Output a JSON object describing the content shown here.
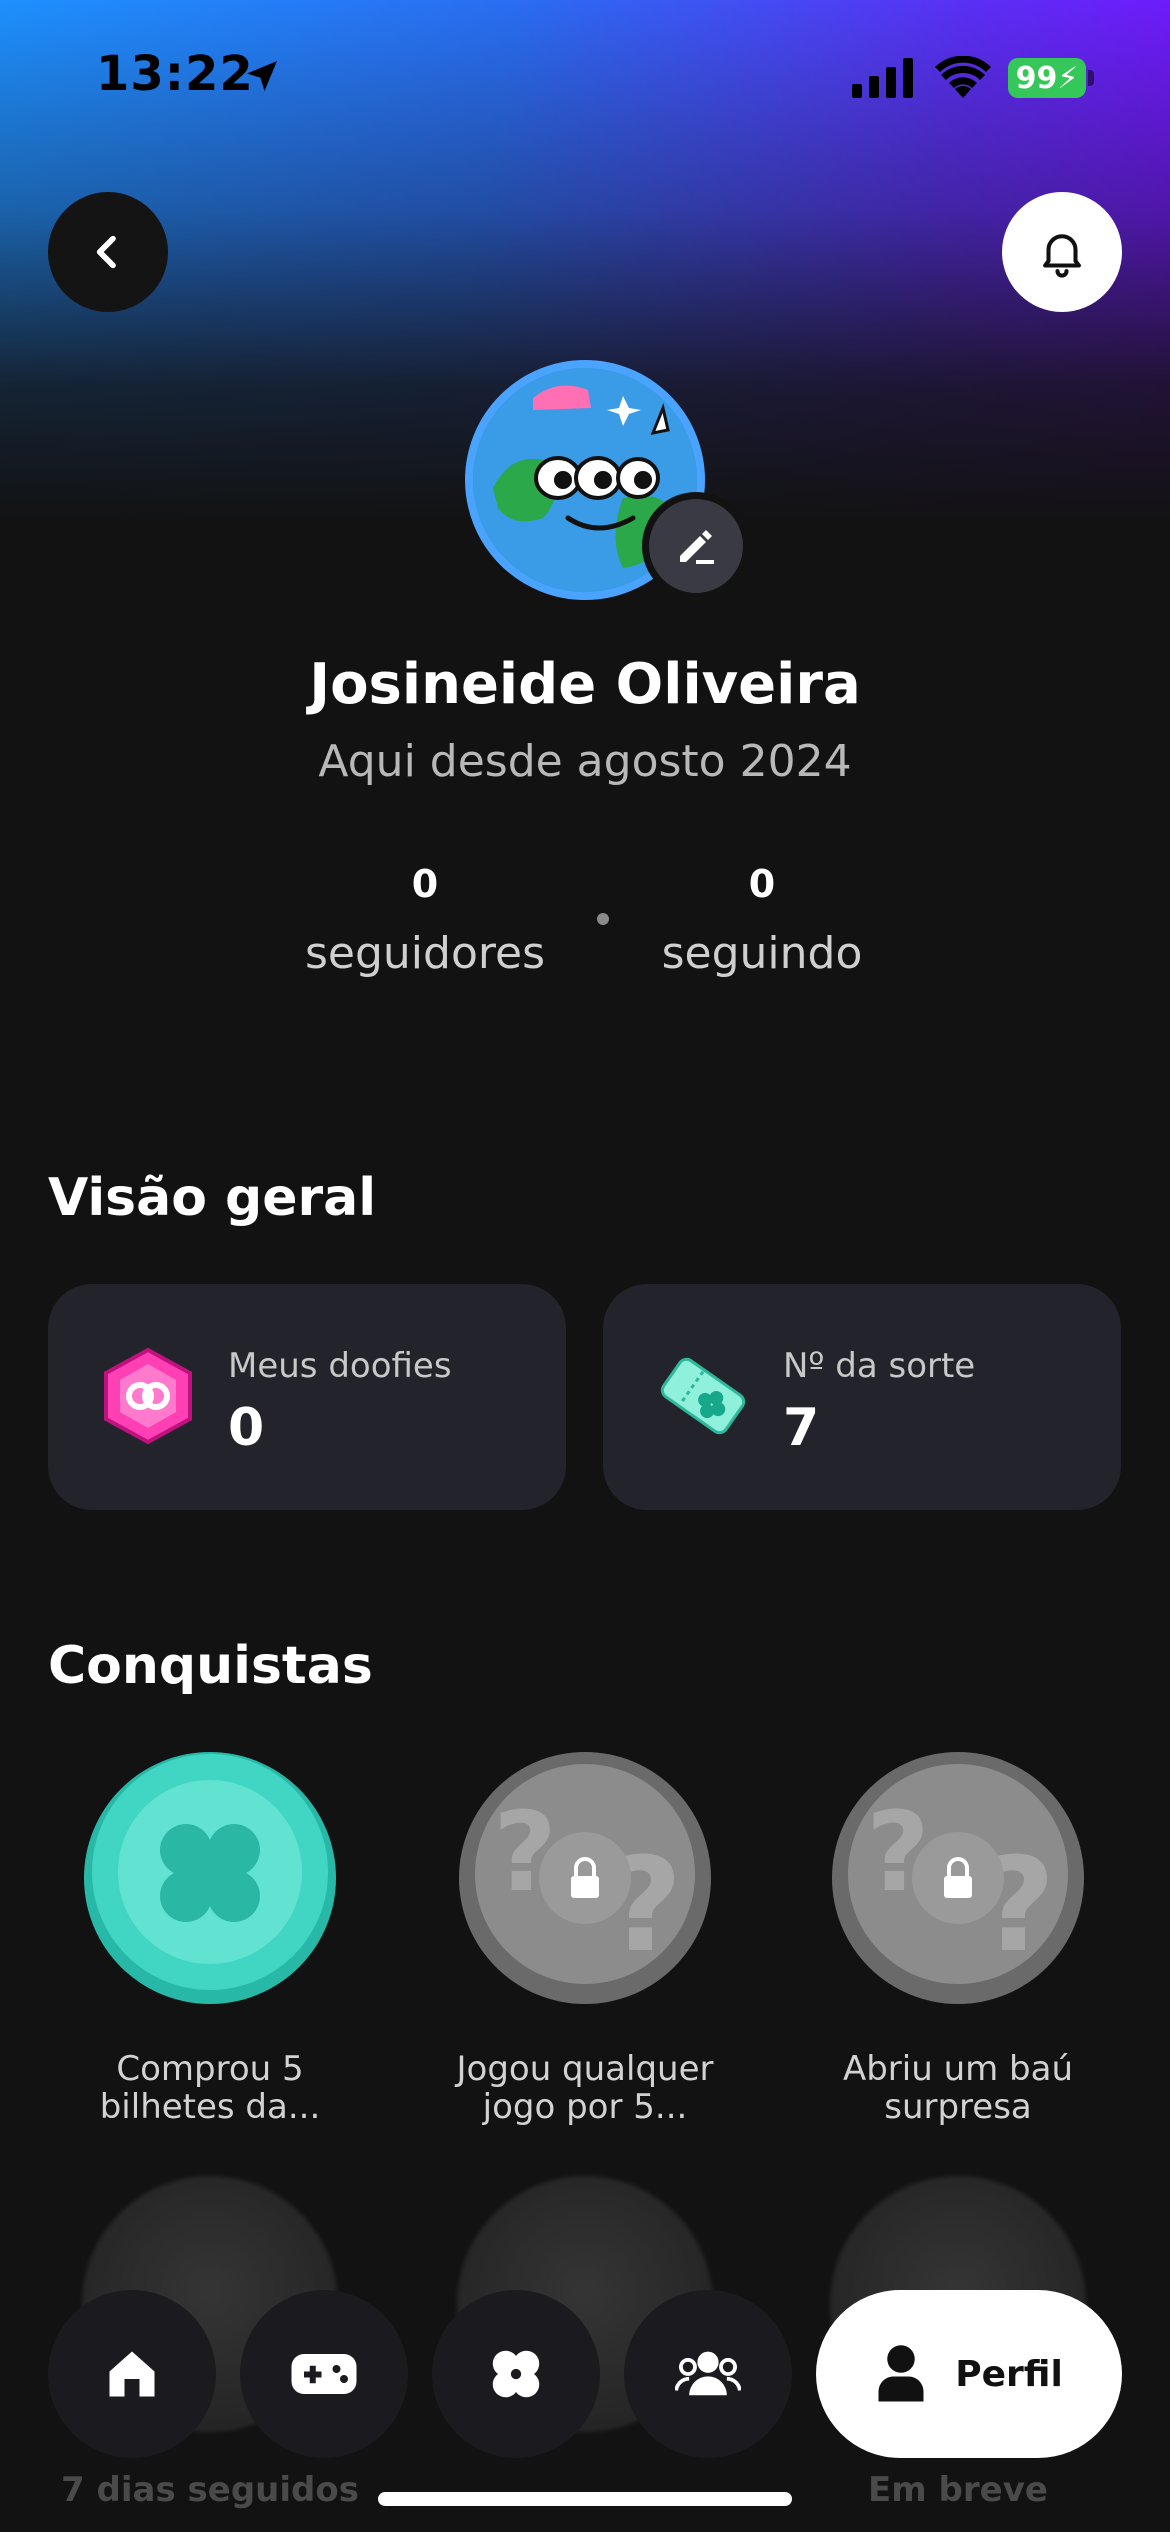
{
  "status_bar": {
    "time": "13:22",
    "battery": "99"
  },
  "profile": {
    "name": "Josineide Oliveira",
    "since": "Aqui desde agosto 2024",
    "followers_count": "0",
    "followers_label": "seguidores",
    "following_count": "0",
    "following_label": "seguindo"
  },
  "overview": {
    "title": "Visão geral",
    "cards": [
      {
        "label": "Meus doofies",
        "value": "0",
        "icon": "doofie-gem-icon",
        "color": "#ff3fb4"
      },
      {
        "label": "Nº da sorte",
        "value": "7",
        "icon": "lucky-ticket-icon",
        "color": "#7fe6cf"
      }
    ]
  },
  "achievements": {
    "title": "Conquistas",
    "items": [
      {
        "caption": "Comprou 5 bilhetes da...",
        "unlocked": true,
        "icon": "clover-medal-icon"
      },
      {
        "caption": "Jogou qualquer jogo por 5...",
        "unlocked": false,
        "icon": "locked-medal-icon"
      },
      {
        "caption": "Abriu um baú surpresa",
        "unlocked": false,
        "icon": "locked-medal-icon"
      }
    ],
    "faded_captions": [
      "7 dias seguidos",
      "",
      "Em breve"
    ]
  },
  "nav": {
    "items": [
      "home-icon",
      "gamepad-icon",
      "clover-icon",
      "friends-icon"
    ],
    "profile_label": "Perfil"
  },
  "colors": {
    "accent_blue": "#1e90ff",
    "accent_purple": "#7a10ff",
    "card_bg": "#23232b",
    "teal": "#34d1c0"
  }
}
